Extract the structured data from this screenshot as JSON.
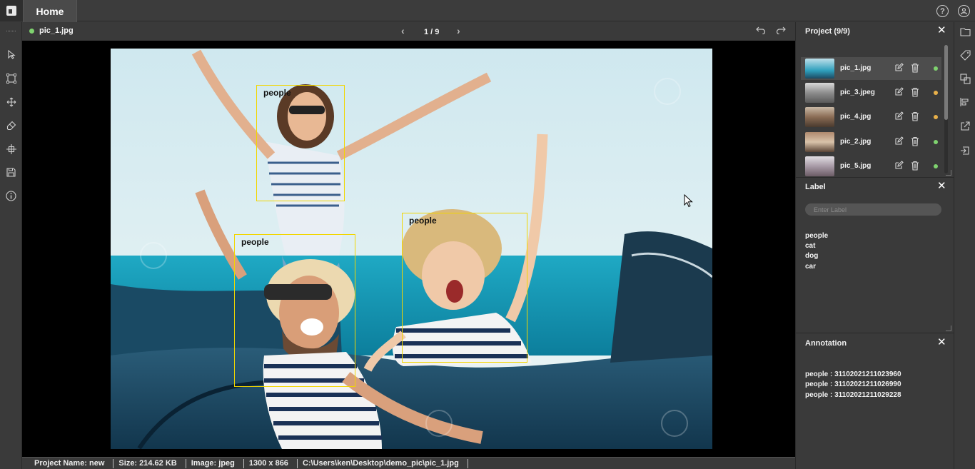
{
  "app": {
    "tab_home": "Home"
  },
  "canvas_header": {
    "file_name": "pic_1.jpg",
    "file_status_color": "#7fd36f",
    "page_indicator": "1 / 9"
  },
  "annotations_on_image": [
    {
      "label": "people"
    },
    {
      "label": "people"
    },
    {
      "label": "people"
    }
  ],
  "status_bar": {
    "project_name": "Project Name: new",
    "size": "Size: 214.62 KB",
    "image_type": "Image: jpeg",
    "dimensions": "1300 x 866",
    "path": "C:\\Users\\ken\\Desktop\\demo_pic\\pic_1.jpg"
  },
  "project_panel": {
    "title": "Project (9/9)",
    "files": [
      {
        "name": "pic_1.jpg",
        "status_color": "#7fd36f",
        "active": true
      },
      {
        "name": "pic_3.jpeg",
        "status_color": "#e8b04a",
        "active": false
      },
      {
        "name": "pic_4.jpg",
        "status_color": "#e8b04a",
        "active": false
      },
      {
        "name": "pic_2.jpg",
        "status_color": "#7fd36f",
        "active": false
      },
      {
        "name": "pic_5.jpg",
        "status_color": "#7fd36f",
        "active": false
      }
    ]
  },
  "label_panel": {
    "title": "Label",
    "input_placeholder": "Enter Label",
    "labels": [
      "people",
      "cat",
      "dog",
      "car"
    ]
  },
  "annotation_panel": {
    "title": "Annotation",
    "items": [
      "people : 31102021211023960",
      "people : 31102021211026990",
      "people : 31102021211029228"
    ]
  },
  "colors": {
    "bbox": "#f2d600",
    "panel_bg": "#3a3a3a",
    "canvas_bg": "#000000"
  },
  "icons": {
    "left_toolbar": [
      "pointer-icon",
      "rectangle-icon",
      "move-icon",
      "eraser-icon",
      "crosshair-icon",
      "save-icon",
      "info-icon"
    ],
    "right_toolbar": [
      "folder-icon",
      "tag-icon",
      "layers-icon",
      "align-icon",
      "export-icon",
      "import-icon"
    ],
    "top_right": [
      "help-icon",
      "user-icon"
    ]
  }
}
